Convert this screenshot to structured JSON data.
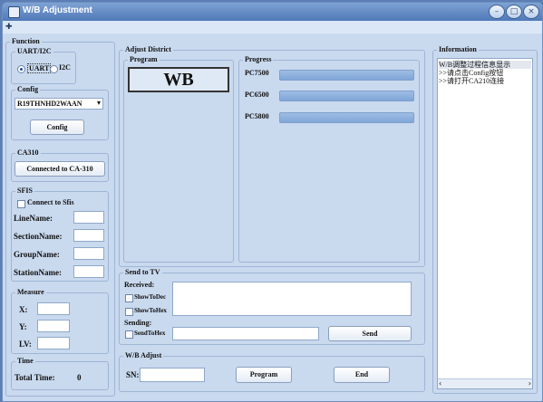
{
  "window": {
    "title": "W/B Adjustment"
  },
  "function": {
    "legend": "Function",
    "uart_i2c": {
      "legend": "UART/I2C",
      "uart_label": "UART",
      "i2c_label": "I2C",
      "selected": "UART"
    },
    "config": {
      "legend": "Config",
      "select_value": "R19THNHD2WAAN",
      "button_label": "Config"
    },
    "ca310": {
      "legend": "CA310",
      "button_label": "Connected to CA-310"
    },
    "sfis": {
      "legend": "SFIS",
      "checkbox_label": "Connect to Sfis",
      "fields": [
        {
          "label": "LineName:",
          "value": ""
        },
        {
          "label": "SectionName:",
          "value": ""
        },
        {
          "label": "GroupName:",
          "value": ""
        },
        {
          "label": "StationName:",
          "value": ""
        }
      ]
    },
    "measure": {
      "legend": "Measure",
      "fields": [
        {
          "label": "X:",
          "value": ""
        },
        {
          "label": "Y:",
          "value": ""
        },
        {
          "label": "LV:",
          "value": ""
        }
      ]
    },
    "time": {
      "legend": "Time",
      "label": "Total Time:",
      "value": "0"
    }
  },
  "adjust_district": {
    "legend": "Adjust District",
    "program": {
      "legend": "Program",
      "display": "WB"
    },
    "progress": {
      "legend": "Progress",
      "items": [
        {
          "label": "PC7500",
          "fraction": 1.0
        },
        {
          "label": "PC6500",
          "fraction": 1.0
        },
        {
          "label": "PC5800",
          "fraction": 1.0
        }
      ]
    }
  },
  "send_to_tv": {
    "legend": "Send to TV",
    "received_label": "Received:",
    "show_to_dec": "ShowToDec",
    "show_to_hex": "ShowToHex",
    "sending_label": "Sending:",
    "send_to_hex": "SendToHex",
    "send_button": "Send"
  },
  "wb_adjust": {
    "legend": "W/B Adjust",
    "sn_label": "SN:",
    "sn_value": "",
    "program_button": "Program",
    "end_button": "End"
  },
  "information": {
    "legend": "Information",
    "lines": [
      "W/B调整过程信息显示",
      ">>请点击Config按钮",
      ">>请打开CA210连接"
    ]
  }
}
